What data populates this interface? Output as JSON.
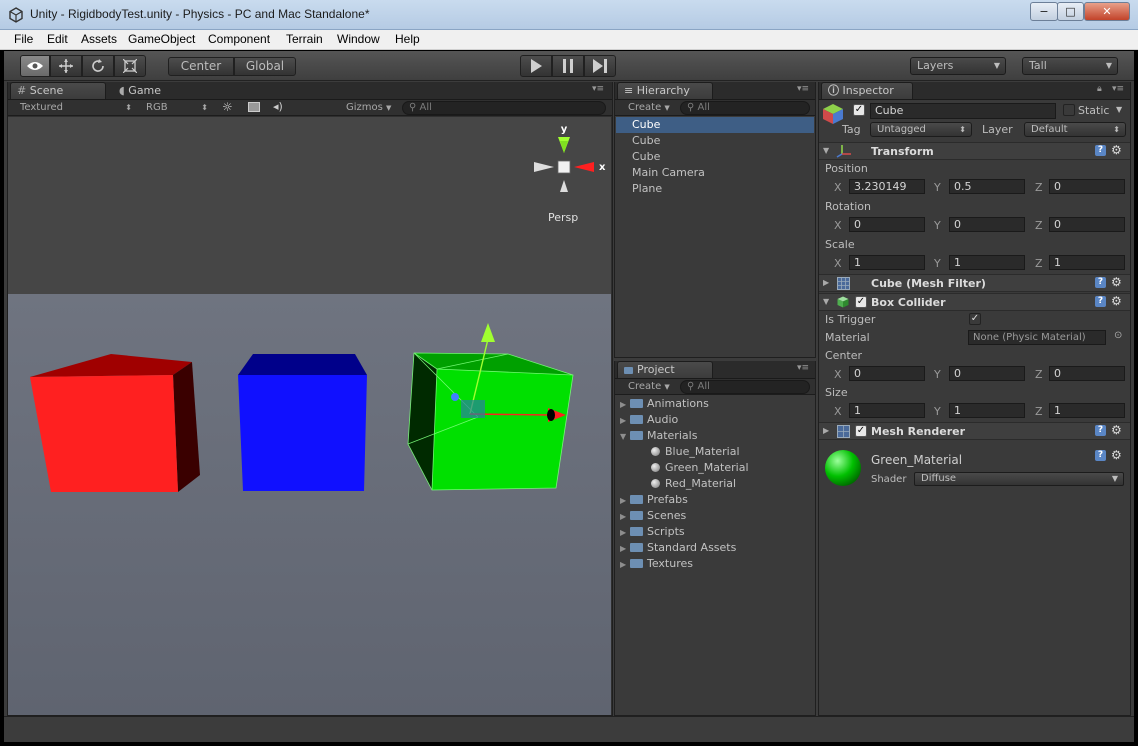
{
  "window": {
    "title": "Unity - RigidbodyTest.unity - Physics - PC and Mac Standalone*",
    "minimize": "−",
    "maximize": "□",
    "close": "✕"
  },
  "menu": [
    "File",
    "Edit",
    "Assets",
    "GameObject",
    "Component",
    "Terrain",
    "Window",
    "Help"
  ],
  "toolbar": {
    "pivot_mode": "Center",
    "pivot_rotation": "Global",
    "layers": "Layers",
    "layout": "Tall"
  },
  "scene": {
    "tab_scene": "Scene",
    "tab_game": "Game",
    "render_mode": "Textured",
    "color_mode": "RGB",
    "gizmos": "Gizmos",
    "search": "All",
    "persp": "Persp",
    "gizmo_y": "y",
    "gizmo_x": "x"
  },
  "hierarchy": {
    "tab": "Hierarchy",
    "create": "Create",
    "search": "All",
    "items": [
      "Cube",
      "Cube",
      "Cube",
      "Main Camera",
      "Plane"
    ]
  },
  "project": {
    "tab": "Project",
    "create": "Create",
    "search": "All",
    "folders_top": [
      "Animations",
      "Audio"
    ],
    "materials_folder": "Materials",
    "materials": [
      "Blue_Material",
      "Green_Material",
      "Red_Material"
    ],
    "folders_bottom": [
      "Prefabs",
      "Scenes",
      "Scripts",
      "Standard Assets",
      "Textures"
    ]
  },
  "inspector": {
    "tab": "Inspector",
    "object_name": "Cube",
    "static": "Static",
    "tag_label": "Tag",
    "tag_value": "Untagged",
    "layer_label": "Layer",
    "layer_value": "Default",
    "transform": {
      "title": "Transform",
      "position_label": "Position",
      "position": {
        "x": "3.230149",
        "y": "0.5",
        "z": "0"
      },
      "rotation_label": "Rotation",
      "rotation": {
        "x": "0",
        "y": "0",
        "z": "0"
      },
      "scale_label": "Scale",
      "scale": {
        "x": "1",
        "y": "1",
        "z": "1"
      }
    },
    "mesh_filter": "Cube (Mesh Filter)",
    "box_collider": {
      "title": "Box Collider",
      "is_trigger_label": "Is Trigger",
      "material_label": "Material",
      "material_value": "None (Physic Material)",
      "center_label": "Center",
      "center": {
        "x": "0",
        "y": "0",
        "z": "0"
      },
      "size_label": "Size",
      "size": {
        "x": "1",
        "y": "1",
        "z": "1"
      }
    },
    "mesh_renderer": "Mesh Renderer",
    "material": {
      "name": "Green_Material",
      "shader_label": "Shader",
      "shader_value": "Diffuse"
    },
    "axis_x": "X",
    "axis_y": "Y",
    "axis_z": "Z"
  },
  "colors": {
    "red_cube": "#ff2b2b",
    "blue_cube": "#1a1aff",
    "green_cube": "#00e000",
    "selection": "#3e5e85"
  }
}
